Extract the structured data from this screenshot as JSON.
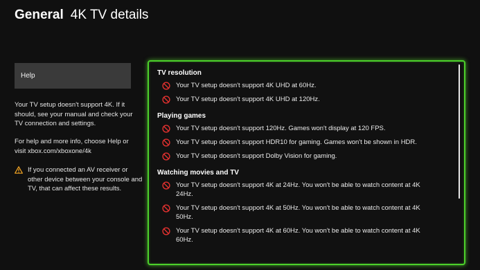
{
  "header": {
    "section": "General",
    "title": "4K TV details"
  },
  "sidebar": {
    "help_label": "Help",
    "paragraph1": "Your TV setup doesn't support 4K. If it should, see your manual and check your TV connection and settings.",
    "paragraph2": "For help and more info, choose Help or visit xbox.com/xboxone/4k",
    "warning": "If you connected an AV receiver or other device between your console and TV, that can affect these results."
  },
  "details": {
    "groups": [
      {
        "title": "TV resolution",
        "items": [
          "Your TV setup doesn't support 4K UHD at 60Hz.",
          "Your TV setup doesn't support 4K UHD at 120Hz."
        ]
      },
      {
        "title": "Playing games",
        "items": [
          "Your TV setup doesn't support 120Hz. Games won't display at 120 FPS.",
          "Your TV setup doesn't support HDR10 for gaming. Games won't be shown in HDR.",
          "Your TV setup doesn't support Dolby Vision for gaming."
        ]
      },
      {
        "title": "Watching movies and TV",
        "items": [
          "Your TV setup doesn't support 4K at 24Hz. You won't be able to watch content at 4K 24Hz.",
          "Your TV setup doesn't support 4K at 50Hz. You won't be able to watch content at 4K 50Hz.",
          "Your TV setup doesn't support 4K at 60Hz. You won't be able to watch content at 4K 60Hz."
        ]
      }
    ]
  },
  "colors": {
    "accent": "#4cd12b",
    "not_supported": "#e2312f",
    "warning": "#f5a623"
  },
  "icons": {
    "not_supported": "prohibited-icon",
    "warning": "warning-triangle-icon"
  }
}
